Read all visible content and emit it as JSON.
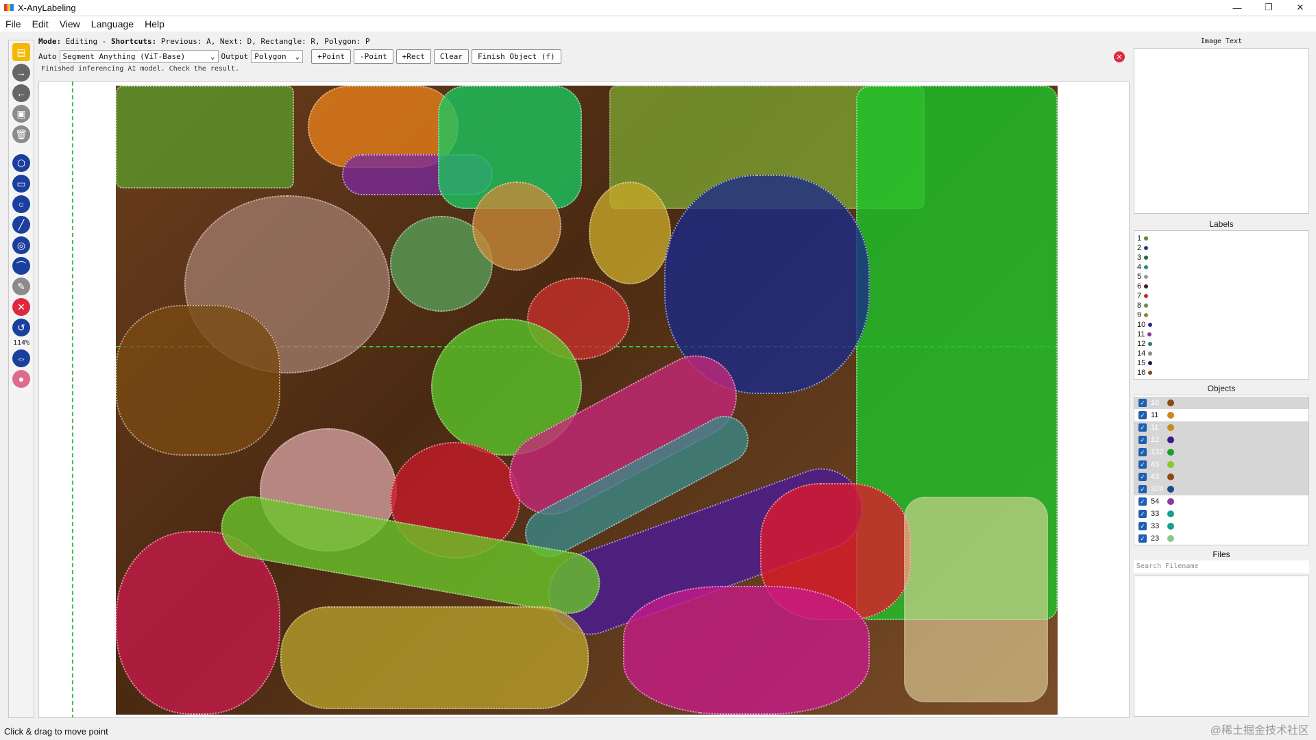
{
  "window": {
    "title": "X-AnyLabeling",
    "controls": [
      "—",
      "❐",
      "✕"
    ]
  },
  "menu": [
    {
      "label": "File"
    },
    {
      "label": "Edit"
    },
    {
      "label": "View"
    },
    {
      "label": "Language"
    },
    {
      "label": "Help"
    }
  ],
  "mode": {
    "mode_label": "Mode:",
    "mode_value": "Editing",
    "shortcuts_label": "Shortcuts:",
    "shortcuts_text": "Previous: A, Next: D, Rectangle: R, Polygon: P"
  },
  "auto": {
    "auto_label": "Auto",
    "model_value": "Segment Anything (ViT-Base)",
    "output_label": "Output",
    "output_value": "Polygon",
    "buttons": [
      "+Point",
      "-Point",
      "+Rect",
      "Clear",
      "Finish Object (f)"
    ],
    "status": "Finished inferencing AI model. Check the result."
  },
  "toolbar": {
    "zoom": "114%"
  },
  "right": {
    "image_text_title": "Image Text",
    "labels_title": "Labels",
    "labels": [
      {
        "name": "1",
        "color": "#5a8a2a"
      },
      {
        "name": "2",
        "color": "#2a3a8a"
      },
      {
        "name": "3",
        "color": "#1a6a3a"
      },
      {
        "name": "4",
        "color": "#2a8a7a"
      },
      {
        "name": "5",
        "color": "#9a9a9a"
      },
      {
        "name": "6",
        "color": "#4a1a1a"
      },
      {
        "name": "7",
        "color": "#c82a2a"
      },
      {
        "name": "8",
        "color": "#6a8a4a"
      },
      {
        "name": "9",
        "color": "#8a8a3a"
      },
      {
        "name": "10",
        "color": "#2a2a8a"
      },
      {
        "name": "11",
        "color": "#8a3a8a"
      },
      {
        "name": "12",
        "color": "#2a7a7a"
      },
      {
        "name": "14",
        "color": "#8a8a8a"
      },
      {
        "name": "15",
        "color": "#1a1a4a"
      },
      {
        "name": "16",
        "color": "#7a4a1a"
      }
    ],
    "objects_title": "Objects",
    "objects": [
      {
        "name": "16",
        "color": "#8a4a1a",
        "selected": true
      },
      {
        "name": "11",
        "color": "#c88a1a",
        "selected": false
      },
      {
        "name": "11",
        "color": "#c88a1a",
        "selected": true
      },
      {
        "name": "12",
        "color": "#3a1a8a",
        "selected": true
      },
      {
        "name": "132",
        "color": "#1aa02a",
        "selected": true
      },
      {
        "name": "43",
        "color": "#8ac82a",
        "selected": true
      },
      {
        "name": "43",
        "color": "#8a4a1a",
        "selected": true
      },
      {
        "name": "324",
        "color": "#1a4a8a",
        "selected": true
      },
      {
        "name": "54",
        "color": "#8a3a9a",
        "selected": false
      },
      {
        "name": "33",
        "color": "#1aa08a",
        "selected": false
      },
      {
        "name": "33",
        "color": "#1aa08a",
        "selected": false
      },
      {
        "name": "23",
        "color": "#8ac88a",
        "selected": false
      }
    ],
    "files_title": "Files",
    "files_search_placeholder": "Search Filename"
  },
  "status_bar": "Click & drag to move point",
  "watermark": "@稀土掘金技术社区"
}
